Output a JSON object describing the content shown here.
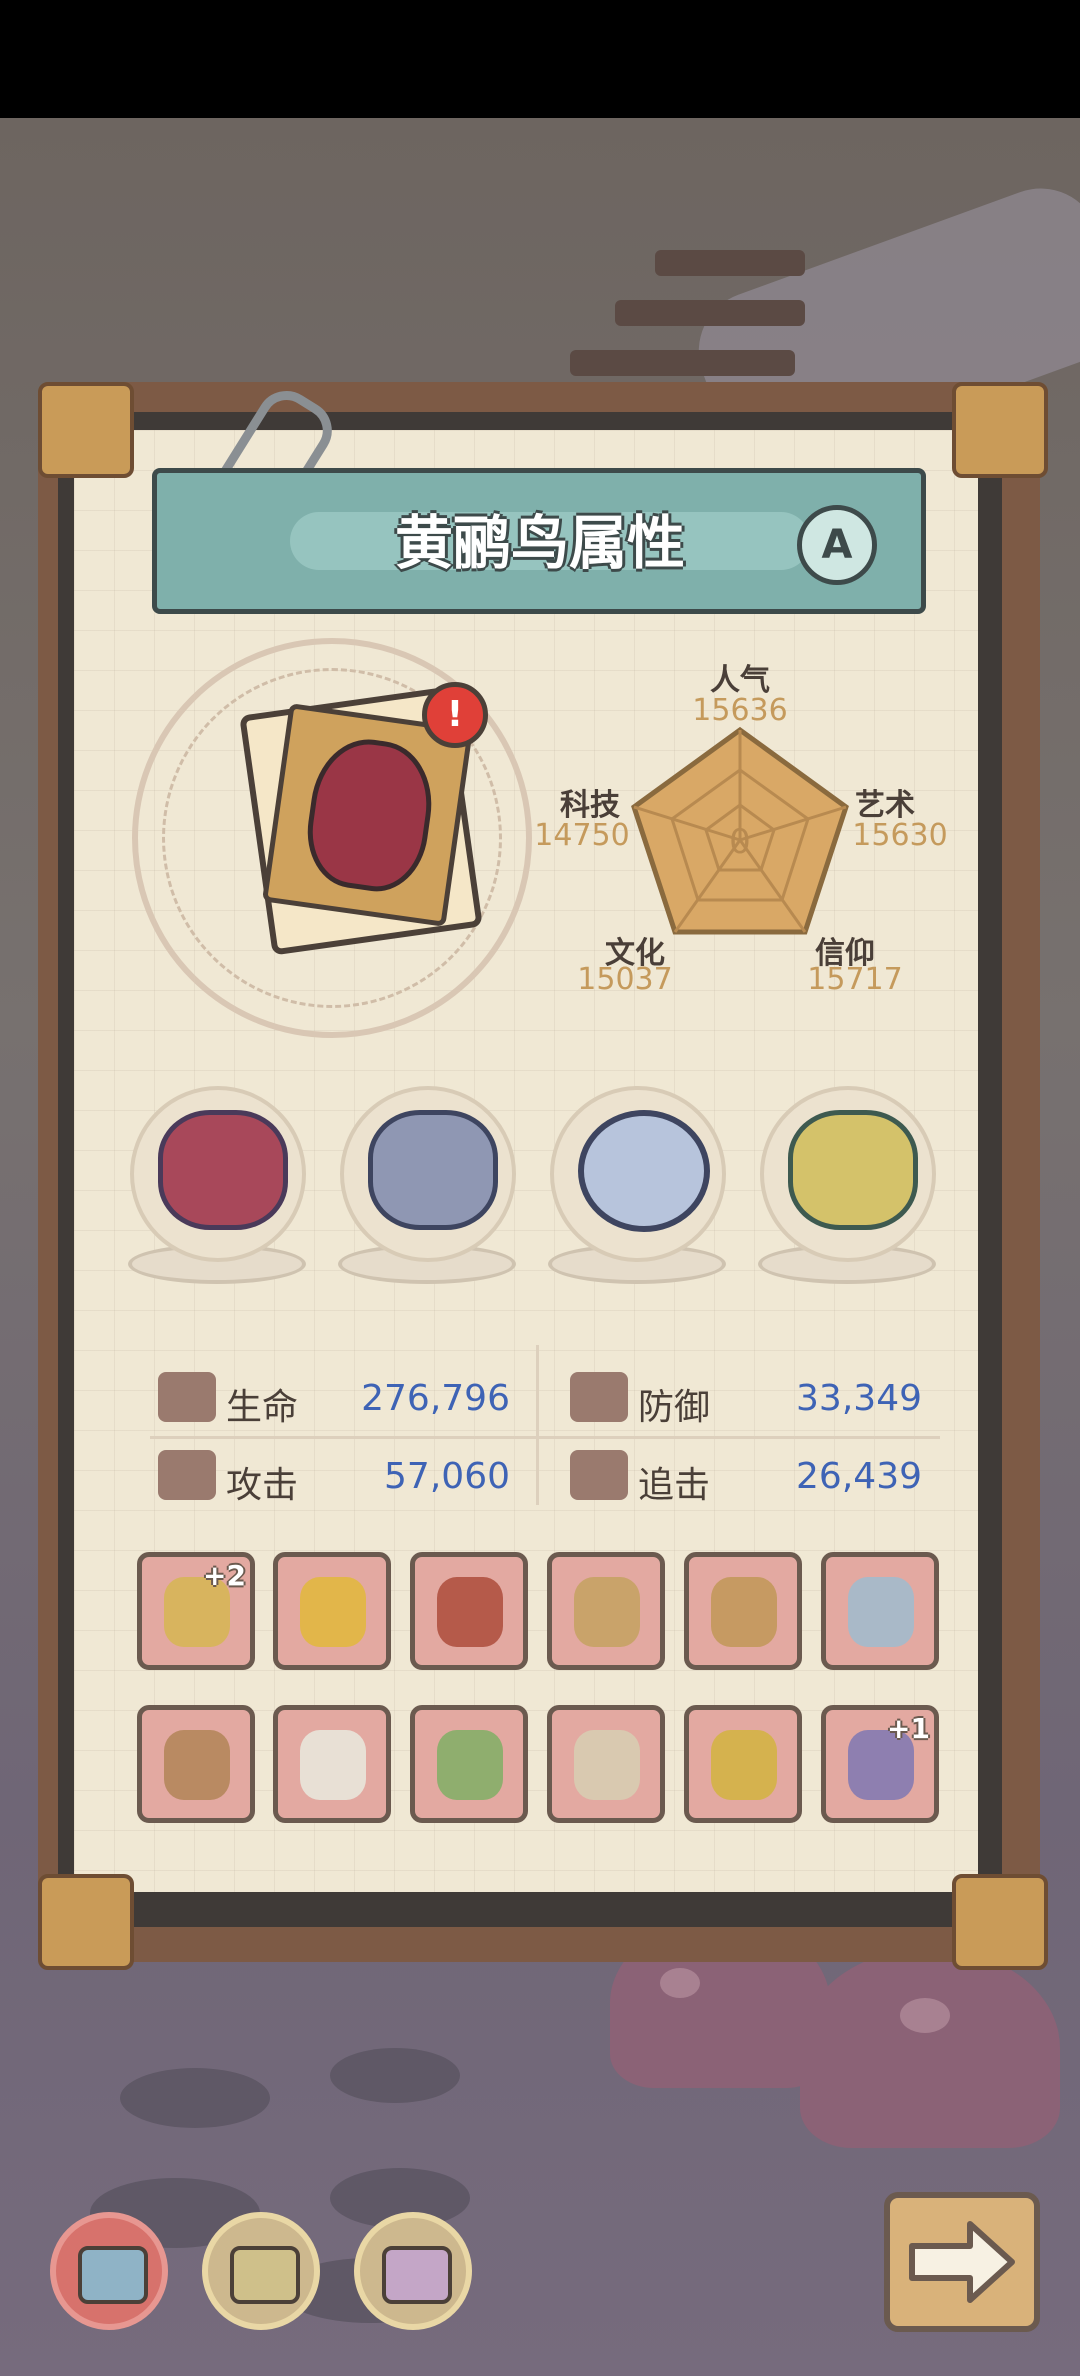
{
  "title": "黄鹂鸟属性",
  "grade": "A",
  "alert_mark": "!",
  "radar": {
    "center_value": "0",
    "stats": [
      {
        "name": "人气",
        "value": "15636"
      },
      {
        "name": "艺术",
        "value": "15630"
      },
      {
        "name": "信仰",
        "value": "15717"
      },
      {
        "name": "文化",
        "value": "15037"
      },
      {
        "name": "科技",
        "value": "14750"
      }
    ]
  },
  "attributes": [
    {
      "label": "生命",
      "value": "276,796"
    },
    {
      "label": "防御",
      "value": "33,349"
    },
    {
      "label": "攻击",
      "value": "57,060"
    },
    {
      "label": "追击",
      "value": "26,439"
    }
  ],
  "equipment_badges": {
    "slot_1": "+2",
    "slot_12": "+1"
  },
  "colors": {
    "accent_value": "#3e63b5",
    "radar_fill": "#d9a866",
    "title_bar": "#7fb0ab",
    "slot_bg": "#e3a9a1"
  },
  "icons": {
    "relics": [
      "thorn-orb-icon",
      "stone-wing-icon",
      "compass-icon",
      "flame-brazier-icon"
    ],
    "equipment": [
      "spiked-staff-icon",
      "golden-mace-icon",
      "rocket-sword-icon",
      "armor-icon",
      "skull-mace-icon",
      "sword-icon",
      "bow-icon",
      "robe-icon",
      "hammer-icon",
      "pants-icon",
      "crown-icon",
      "scythe-icon"
    ],
    "nav": [
      "tab-1-icon",
      "tab-2-icon",
      "tab-3-icon"
    ],
    "next": "arrow-right-icon"
  }
}
